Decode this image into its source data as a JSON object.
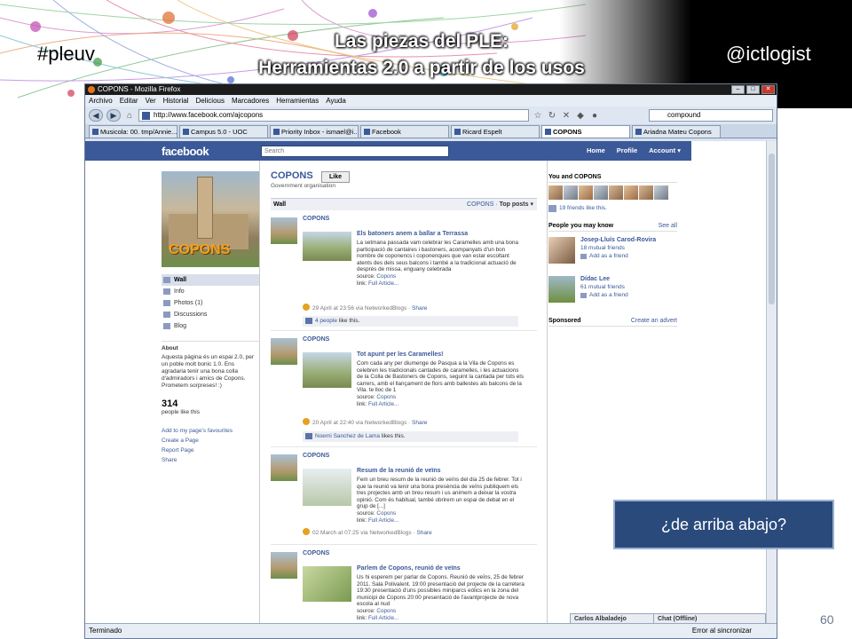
{
  "slide": {
    "title_line1": "Las piezas del PLE:",
    "title_line2": "Herramientas 2.0 a partir de los usos",
    "hashtag": "#pleuv",
    "handle": "@ictlogist",
    "callout": "¿de arriba abajo?",
    "page_number": "60"
  },
  "browser": {
    "window_title": "COPONS - Mozilla Firefox",
    "menu": [
      "Archivo",
      "Editar",
      "Ver",
      "Historial",
      "Delicious",
      "Marcadores",
      "Herramientas",
      "Ayuda"
    ],
    "url": "http://www.facebook.com/ajcopons",
    "search_value": "compound",
    "tabs": [
      "Musicola: 00. tmp/Annie...",
      "Campus 5.0 - UOC",
      "Priority Inbox - ismael@i...",
      "Facebook",
      "Ricard Espelt",
      "COPONS",
      "Ariadna Mateu Copons"
    ],
    "status": "Terminado",
    "status_right": "Error al sincronizar"
  },
  "facebook": {
    "logo": "facebook",
    "search_placeholder": "Search",
    "nav": [
      "Home",
      "Profile",
      "Account ▾"
    ],
    "page_name": "COPONS",
    "like_button": "Like",
    "page_category": "Government organisation",
    "profile_overlay": "COPONS",
    "sidebar": [
      "Wall",
      "Info",
      "Photos (1)",
      "Discussions",
      "Blog"
    ],
    "about_title": "About",
    "about_text": "Aquesta pàgina és un espai 2.0, per un poble molt bonic 1.0. Ens agradaria tenir una bona colla d'admiradors i amics de Copons. Prometem sorpreses! :)",
    "likes_count": "314",
    "likes_label": "people like this",
    "side_links": [
      "Add to my page's favourites",
      "Create a Page",
      "Report Page",
      "Share"
    ],
    "wall_label": "Wall",
    "wall_sort_prefix": "COPONS ·",
    "wall_sort": "Top posts ▾",
    "posts": [
      {
        "author": "COPONS",
        "title": "Els batoners anem a ballar a Terrassa",
        "text": "La setmana passada vam celebrar les Caramelles amb una bona participació de cantaires i bastoners, acompanyats d'un bon nombre de coponencs i coponenques que van estar escoltant atents des dels seus balcons i també a la tradicional actuació de després de missa, enguany celebrada",
        "source_label": "source:",
        "source": "Copons",
        "link_label": "link:",
        "link": "Full Article...",
        "meta": "29 April at 23:56 via NetworkedBlogs ·",
        "share": "Share",
        "likes_link": "4 people",
        "likes_rest": "like this."
      },
      {
        "author": "COPONS",
        "title": "Tot apunt per les Caramelles!",
        "text": "Com cada any per diumenge de Pasqua a la Vila de Copons es celebren les tradicionals cantades de caramelles, i les actuacions de la Colla de Bastoners de Copons, seguint la cantada per tots els carrers, amb el llançament de flors amb ballestes als balcons de la Vila. te lloc de 1",
        "source_label": "source:",
        "source": "Copons",
        "link_label": "link:",
        "link": "Full Article...",
        "meta": "20 April at 22:40 via NetworkedBlogs ·",
        "share": "Share",
        "likes_link": "Noemi Sanchez de Lama",
        "likes_rest": "likes this."
      },
      {
        "author": "COPONS",
        "title": "Resum de la reunió de veïns",
        "text": "Fem un breu resum de la reunió de veïns del dia 25 de febrer. Tot i que la reunió va tenir una bona presència de veïns publiquem els tres projectes amb un breu resum i us animem a deixar la vostra opinió. Com és habitual, també obrirem un espai de debat en el grup de [...]",
        "source_label": "source:",
        "source": "Copons",
        "link_label": "link:",
        "link": "Full Article...",
        "meta": "02 March at 07:25 via NetworkedBlogs ·",
        "share": "Share"
      },
      {
        "author": "COPONS",
        "title": "Parlem de Copons, reunió de veïns",
        "text": "Us hi esperem per parlar de Copons. Reunió de veïns, 25 de febrer 2011. Sala Polivalent. 19:00 presentació del projecte de la carretera 19:30 presentació d'uns possibles miniparcs eòlics en la zona del municipi de Copons 20:00 presentació de l'avantprojecte de nova escola al nud",
        "source_label": "source:",
        "source": "Copons",
        "link_label": "link:",
        "link": "Full Article..."
      }
    ],
    "friends_box_title": "You and COPONS",
    "friends_like": "19 friends like this.",
    "pymk_title": "People you may know",
    "see_all": "See all",
    "pymk": [
      {
        "name": "Josep-Lluís Carod-Rovira",
        "mutual": "18 mutual friends",
        "add": "Add as a friend"
      },
      {
        "name": "Dídac Lee",
        "mutual": "61 mutual friends",
        "add": "Add as a friend"
      }
    ],
    "sponsored": "Sponsored",
    "create_advert": "Create an advert",
    "chat_user": "Carlos Albaladejo",
    "chat_status": "Chat (Offline)"
  }
}
